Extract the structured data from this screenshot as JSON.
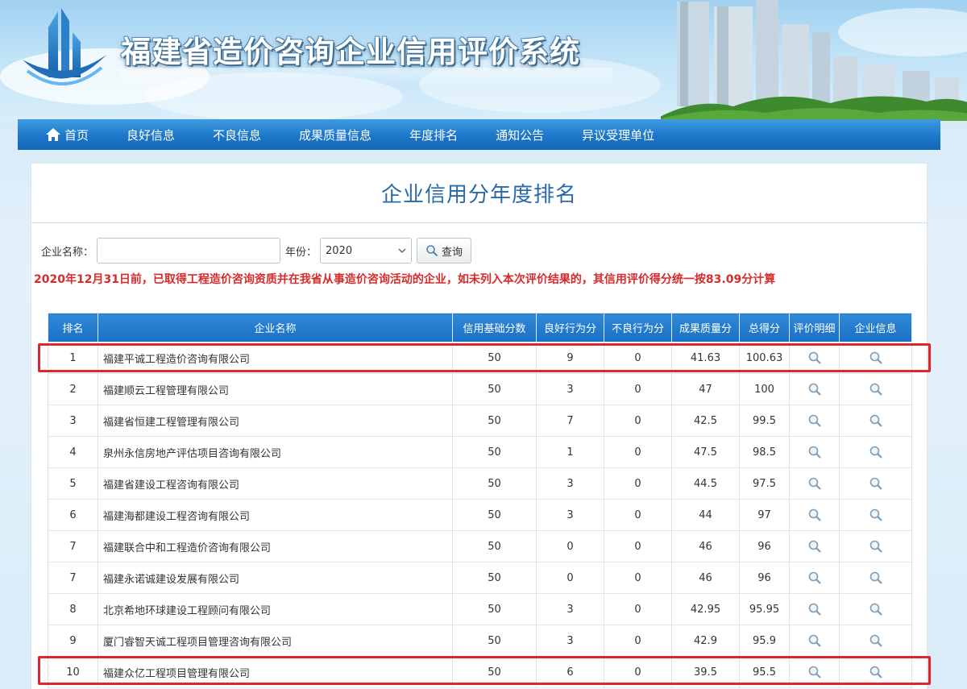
{
  "site": {
    "title": "福建省造价咨询企业信用评价系统"
  },
  "nav": {
    "items": [
      {
        "label": "首页",
        "icon": "home-icon"
      },
      {
        "label": "良好信息"
      },
      {
        "label": "不良信息"
      },
      {
        "label": "成果质量信息"
      },
      {
        "label": "年度排名"
      },
      {
        "label": "通知公告"
      },
      {
        "label": "异议受理单位"
      }
    ]
  },
  "panel": {
    "title": "企业信用分年度排名"
  },
  "search": {
    "name_label": "企业名称：",
    "name_value": "",
    "year_label": "年份：",
    "year_value": "2020",
    "query_label": "查询"
  },
  "notice": "2020年12月31日前，已取得工程造价咨询资质并在我省从事造价咨询活动的企业，如未列入本次评价结果的，其信用评价得分统一按83.09分计算",
  "table": {
    "headers": [
      "排名",
      "企业名称",
      "信用基础分数",
      "良好行为分",
      "不良行为分",
      "成果质量分",
      "总得分",
      "评价明细",
      "企业信息"
    ],
    "rows": [
      {
        "rank": "1",
        "name": "福建平诚工程造价咨询有限公司",
        "base": "50",
        "good": "9",
        "bad": "0",
        "quality": "41.63",
        "total": "100.63"
      },
      {
        "rank": "2",
        "name": "福建顺云工程管理有限公司",
        "base": "50",
        "good": "3",
        "bad": "0",
        "quality": "47",
        "total": "100"
      },
      {
        "rank": "3",
        "name": "福建省恒建工程管理有限公司",
        "base": "50",
        "good": "7",
        "bad": "0",
        "quality": "42.5",
        "total": "99.5"
      },
      {
        "rank": "4",
        "name": "泉州永信房地产评估项目咨询有限公司",
        "base": "50",
        "good": "1",
        "bad": "0",
        "quality": "47.5",
        "total": "98.5"
      },
      {
        "rank": "5",
        "name": "福建省建设工程咨询有限公司",
        "base": "50",
        "good": "3",
        "bad": "0",
        "quality": "44.5",
        "total": "97.5"
      },
      {
        "rank": "6",
        "name": "福建海都建设工程咨询有限公司",
        "base": "50",
        "good": "3",
        "bad": "0",
        "quality": "44",
        "total": "97"
      },
      {
        "rank": "7",
        "name": "福建联合中和工程造价咨询有限公司",
        "base": "50",
        "good": "0",
        "bad": "0",
        "quality": "46",
        "total": "96"
      },
      {
        "rank": "7",
        "name": "福建永诺诚建设发展有限公司",
        "base": "50",
        "good": "0",
        "bad": "0",
        "quality": "46",
        "total": "96"
      },
      {
        "rank": "8",
        "name": "北京希地环球建设工程顾问有限公司",
        "base": "50",
        "good": "3",
        "bad": "0",
        "quality": "42.95",
        "total": "95.95"
      },
      {
        "rank": "9",
        "name": "厦门睿智天诚工程项目管理咨询有限公司",
        "base": "50",
        "good": "3",
        "bad": "0",
        "quality": "42.9",
        "total": "95.9"
      },
      {
        "rank": "10",
        "name": "福建众亿工程项目管理有限公司",
        "base": "50",
        "good": "6",
        "bad": "0",
        "quality": "39.5",
        "total": "95.5"
      }
    ],
    "highlighted_ranks": [
      "1",
      "10"
    ]
  },
  "colors": {
    "nav_blue": "#1d77c9",
    "title_blue": "#2a6aa6",
    "notice_red": "#d62b2b",
    "highlight_red": "#e0262b"
  }
}
